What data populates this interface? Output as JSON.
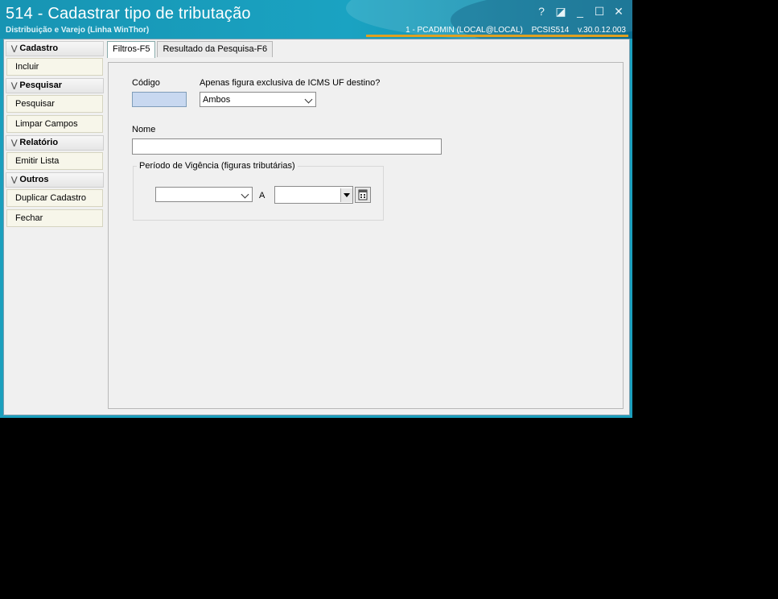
{
  "window": {
    "title": "514 - Cadastrar tipo de tributação",
    "subtitle": "Distribuição e Varejo (Linha WinThor)",
    "session_user": "1 - PCADMIN (LOCAL@LOCAL)",
    "session_module": "PCSIS514",
    "session_version": "v.30.0.12.003",
    "controls": {
      "help": "?",
      "restore_small": "◪",
      "minimize": "_",
      "maximize": "☐",
      "close": "✕"
    }
  },
  "sidebar": {
    "groups": [
      {
        "title": "Cadastro",
        "items": [
          "Incluir"
        ]
      },
      {
        "title": "Pesquisar",
        "items": [
          "Pesquisar",
          "Limpar Campos"
        ]
      },
      {
        "title": "Relatório",
        "items": [
          "Emitir Lista"
        ]
      },
      {
        "title": "Outros",
        "items": [
          "Duplicar Cadastro",
          "Fechar"
        ]
      }
    ]
  },
  "tabs": [
    "Filtros-F5",
    "Resultado da Pesquisa-F6"
  ],
  "form": {
    "codigo_label": "Código",
    "codigo_value": "",
    "icms_label": "Apenas figura exclusiva de ICMS UF destino?",
    "icms_value": "Ambos",
    "nome_label": "Nome",
    "nome_value": "",
    "periodo_label": "Período de Vigência (figuras tributárias)",
    "periodo_from": "",
    "periodo_sep": "A",
    "periodo_to": ""
  },
  "colors": {
    "title_bar": "#1aa3c2",
    "accent": "#e0a020",
    "sidebar_button": "#f7f6ea"
  }
}
